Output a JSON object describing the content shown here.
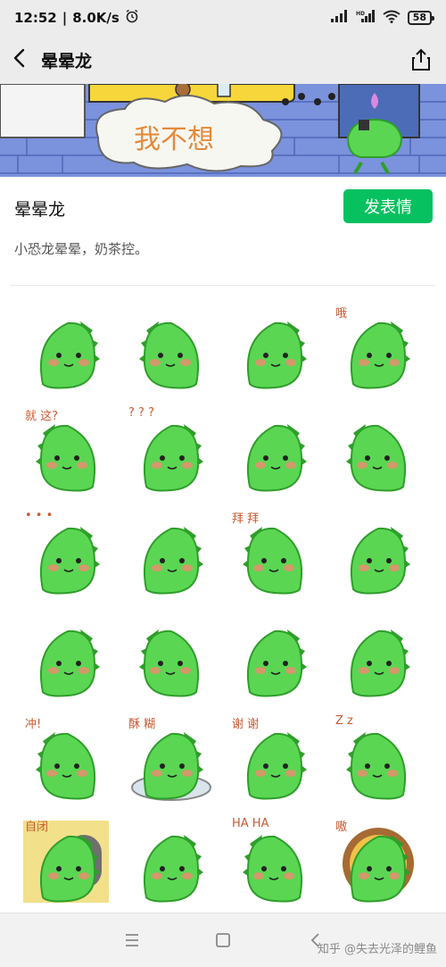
{
  "status_bar": {
    "time": "12:52",
    "network_speed": "8.0K/s",
    "battery": "58",
    "hd_label": "HD"
  },
  "nav": {
    "title": "晕晕龙"
  },
  "banner": {
    "text": "我不想"
  },
  "pack": {
    "title": "晕晕龙",
    "send_label": "发表情",
    "description": "小恐龙晕晕，奶茶控。"
  },
  "stickers": [
    {
      "name": "sticker-1",
      "caption": ""
    },
    {
      "name": "sticker-2",
      "caption": ""
    },
    {
      "name": "sticker-3",
      "caption": ""
    },
    {
      "name": "sticker-4",
      "caption": "哦"
    },
    {
      "name": "sticker-5",
      "caption": "就 这?"
    },
    {
      "name": "sticker-6",
      "caption": "? ? ?"
    },
    {
      "name": "sticker-7",
      "caption": ""
    },
    {
      "name": "sticker-8",
      "caption": ""
    },
    {
      "name": "sticker-9",
      "caption": "• • •"
    },
    {
      "name": "sticker-10",
      "caption": ""
    },
    {
      "name": "sticker-11",
      "caption": "拜 拜"
    },
    {
      "name": "sticker-12",
      "caption": ""
    },
    {
      "name": "sticker-13",
      "caption": ""
    },
    {
      "name": "sticker-14",
      "caption": ""
    },
    {
      "name": "sticker-15",
      "caption": ""
    },
    {
      "name": "sticker-16",
      "caption": ""
    },
    {
      "name": "sticker-17",
      "caption": "冲!"
    },
    {
      "name": "sticker-18",
      "caption": "酥 糊"
    },
    {
      "name": "sticker-19",
      "caption": "谢 谢"
    },
    {
      "name": "sticker-20",
      "caption": "Z z"
    },
    {
      "name": "sticker-21",
      "caption": "自闭"
    },
    {
      "name": "sticker-22",
      "caption": ""
    },
    {
      "name": "sticker-23",
      "caption": "HA HA"
    },
    {
      "name": "sticker-24",
      "caption": "嗷"
    }
  ],
  "watermark": "知乎 @失去光泽的鲤鱼",
  "colors": {
    "accent": "#07c160",
    "dino_body": "#5ad653",
    "dino_dark": "#2f9e2a",
    "cheek": "#f08a70"
  }
}
